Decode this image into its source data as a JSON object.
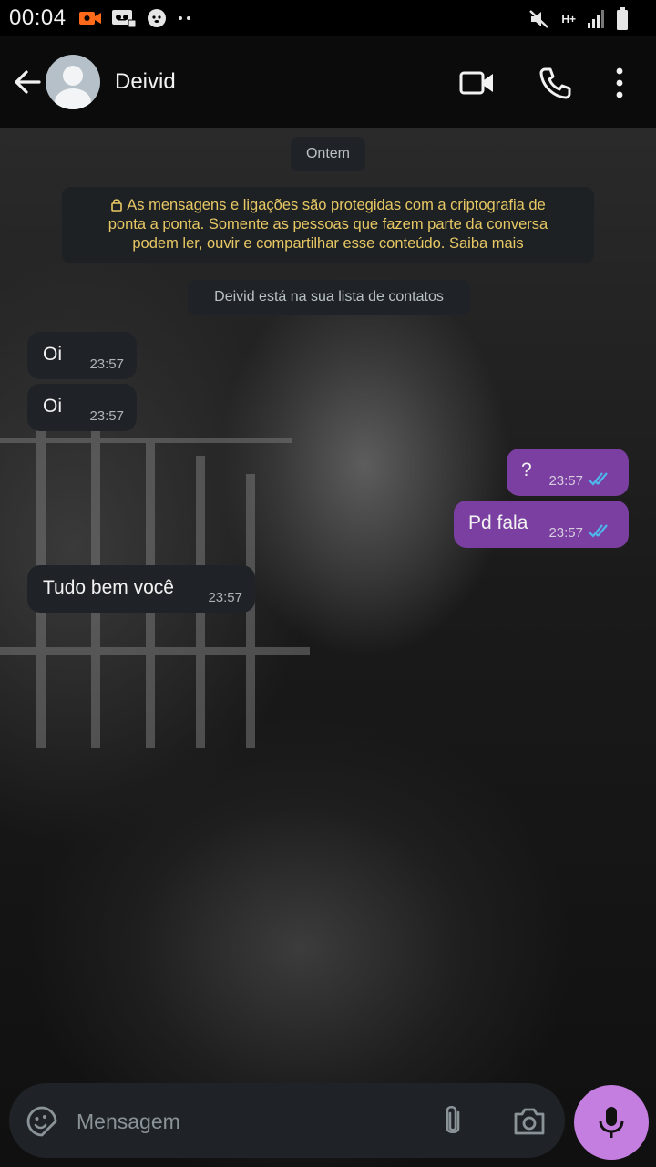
{
  "status_bar": {
    "time": "00:04",
    "network_label": "H+"
  },
  "header": {
    "contact_name": "Deivid",
    "icons": [
      "back-arrow-icon",
      "avatar-placeholder",
      "video-call-icon",
      "phone-icon",
      "more-vert-icon"
    ]
  },
  "chat": {
    "date_divider": "Ontem",
    "e2e_notice_lines": [
      "As mensagens e ligações são protegidas com a criptografia de",
      "ponta a ponta. Somente as pessoas que fazem parte da conversa",
      "podem ler, ouvir e compartilhar esse conteúdo. Saiba mais"
    ],
    "contacts_notice": "Deivid está na sua lista de contatos",
    "messages": [
      {
        "direction": "incoming",
        "text": "Oi",
        "time": "23:57"
      },
      {
        "direction": "incoming",
        "text": "Oi",
        "time": "23:57"
      },
      {
        "direction": "outgoing",
        "text": "?",
        "time": "23:57",
        "status": "read"
      },
      {
        "direction": "outgoing",
        "text": "Pd fala",
        "time": "23:57",
        "status": "read"
      },
      {
        "direction": "incoming",
        "text": "Tudo bem você",
        "time": "23:57"
      }
    ]
  },
  "composer": {
    "placeholder": "Mensagem",
    "icons": [
      "emoji-icon",
      "attach-icon",
      "camera-icon",
      "mic-icon"
    ]
  },
  "colors": {
    "outgoing_bubble": "#7a3fa0",
    "incoming_bubble": "#1f2327",
    "mic_button": "#c47ee0",
    "read_ticks": "#4fb6ec",
    "notice_text": "#e8c864"
  }
}
